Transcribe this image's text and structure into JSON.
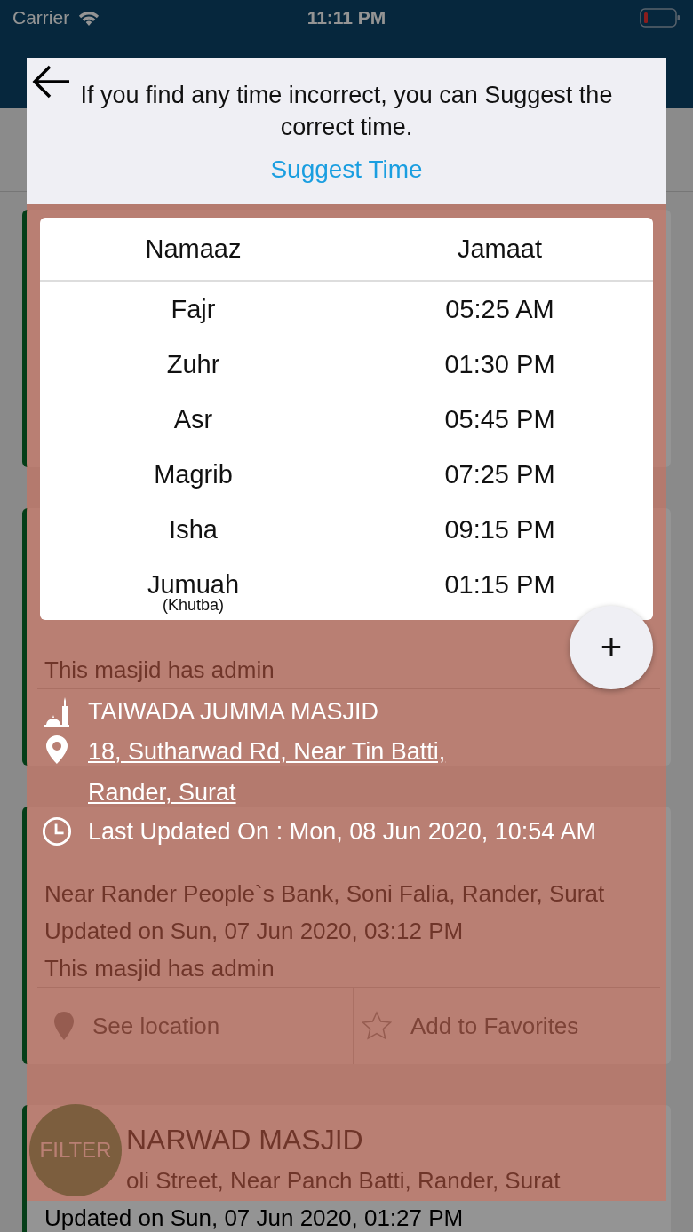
{
  "status_bar": {
    "carrier": "Carrier",
    "time": "11:11 PM"
  },
  "background_cards": [
    {
      "admin_note": "This masjid has admin"
    },
    {
      "address": "Near Rander People`s Bank, Soni Falia, Rander, Surat",
      "updated": "Updated on Sun, 07 Jun 2020, 03:12 PM",
      "admin_note": "This masjid has admin",
      "actions": [
        "See location",
        "Add to Favorites"
      ]
    },
    {
      "name": "NARWAD MASJID",
      "address": "oli Street, Near Panch Batti, Rander, Surat",
      "updated": "Updated on Sun, 07 Jun 2020, 01:27 PM"
    }
  ],
  "filter_button": "FILTER",
  "modal": {
    "notice": "If you find any time incorrect, you can Suggest the correct time.",
    "suggest_link": "Suggest Time",
    "table": {
      "columns": [
        "Namaaz",
        "Jamaat"
      ],
      "rows": [
        {
          "name": "Fajr",
          "time": "05:25 AM"
        },
        {
          "name": "Zuhr",
          "time": "01:30 PM"
        },
        {
          "name": "Asr",
          "time": "05:45 PM"
        },
        {
          "name": "Magrib",
          "time": "07:25 PM"
        },
        {
          "name": "Isha",
          "time": "09:15 PM"
        },
        {
          "name": "Jumuah",
          "note": "(Khutba)",
          "time": "01:15 PM"
        }
      ]
    },
    "add_button": "+",
    "masjid": {
      "name": "TAIWADA JUMMA MASJID",
      "address_lines": [
        "18, Sutharwad Rd, Near Tin Batti,",
        "Rander, Surat"
      ],
      "last_updated": "Last Updated On : Mon, 08 Jun 2020, 10:54 AM"
    }
  }
}
